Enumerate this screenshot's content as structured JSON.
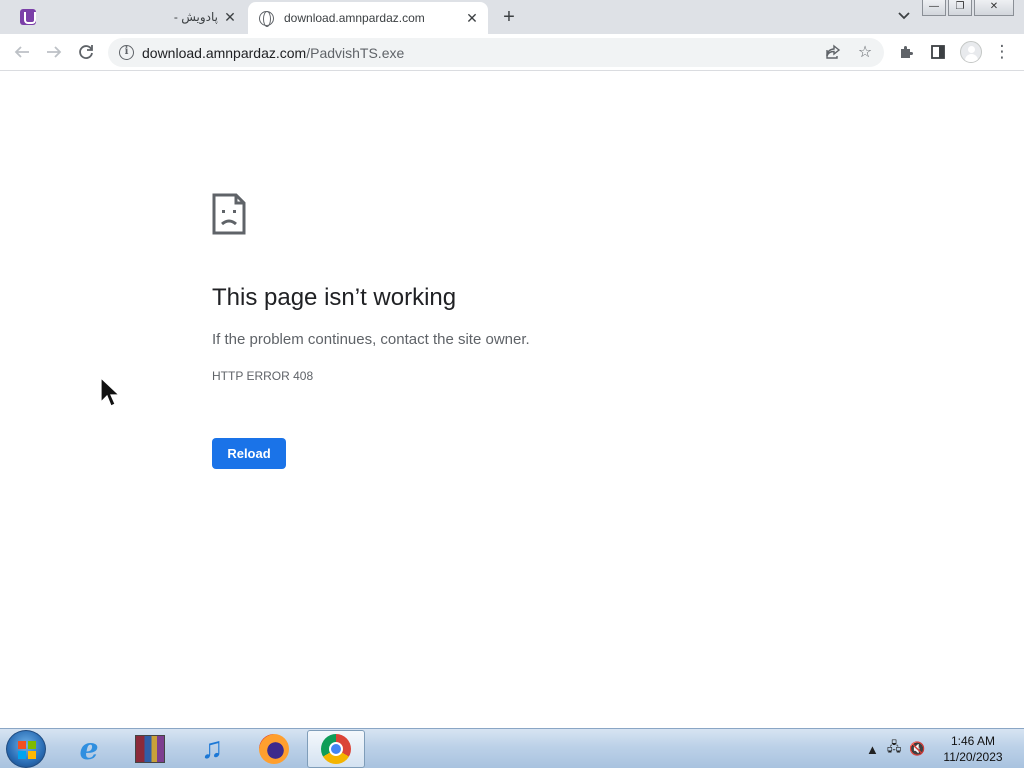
{
  "tabs": [
    {
      "title": "پادویش -",
      "favicon": "padvish-app-icon",
      "active": false
    },
    {
      "title": "download.amnpardaz.com",
      "favicon": "globe-icon",
      "active": true
    }
  ],
  "toolbar": {
    "url_host": "download.amnpardaz.com",
    "url_path": "/PadvishTS.exe"
  },
  "error_page": {
    "title": "This page isn’t working",
    "subtitle": "If the problem continues, contact the site owner.",
    "code": "HTTP ERROR 408",
    "reload_label": "Reload"
  },
  "taskbar": {
    "apps": [
      "internet-explorer",
      "winrar",
      "itunes",
      "firefox",
      "chrome"
    ],
    "active_app": "chrome",
    "clock_time": "1:46 AM",
    "clock_date": "11/20/2023"
  },
  "colors": {
    "accent": "#1a73e8",
    "tabstrip": "#dee1e6",
    "text_primary": "#202124",
    "text_secondary": "#5f6368"
  }
}
